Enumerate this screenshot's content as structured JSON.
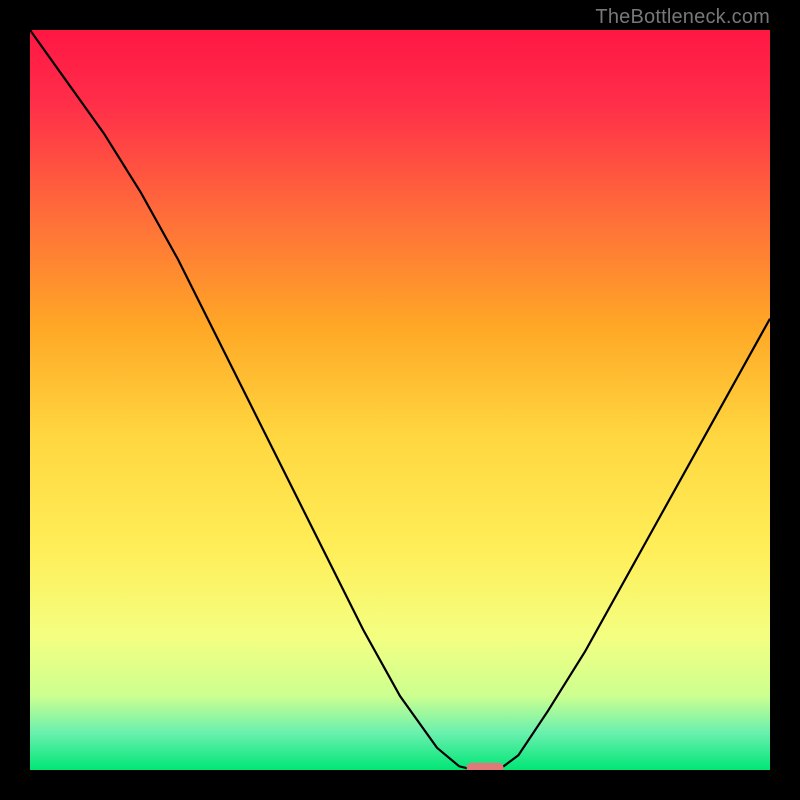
{
  "watermark": "TheBottleneck.com",
  "chart_data": {
    "type": "line",
    "title": "",
    "xlabel": "",
    "ylabel": "",
    "xlim": [
      0,
      100
    ],
    "ylim": [
      0,
      100
    ],
    "x": [
      0,
      5,
      10,
      15,
      20,
      25,
      30,
      35,
      40,
      45,
      50,
      55,
      58,
      60,
      62,
      64,
      66,
      70,
      75,
      80,
      85,
      90,
      95,
      100
    ],
    "values": [
      100,
      93,
      86,
      78,
      69,
      59,
      49,
      39,
      29,
      19,
      10,
      3,
      0.5,
      0,
      0,
      0.5,
      2,
      8,
      16,
      25,
      34,
      43,
      52,
      61
    ],
    "marker": {
      "x_range": [
        59,
        64
      ],
      "y": 0.3
    },
    "gradient_stops": [
      {
        "offset": 0.0,
        "color": "#ff1744"
      },
      {
        "offset": 0.1,
        "color": "#ff2e49"
      },
      {
        "offset": 0.25,
        "color": "#ff6d3a"
      },
      {
        "offset": 0.4,
        "color": "#ffa726"
      },
      {
        "offset": 0.55,
        "color": "#ffd740"
      },
      {
        "offset": 0.7,
        "color": "#ffee58"
      },
      {
        "offset": 0.82,
        "color": "#f4ff81"
      },
      {
        "offset": 0.9,
        "color": "#ccff90"
      },
      {
        "offset": 0.95,
        "color": "#69f0ae"
      },
      {
        "offset": 1.0,
        "color": "#00e676"
      }
    ],
    "marker_color": "#e07a7a"
  }
}
